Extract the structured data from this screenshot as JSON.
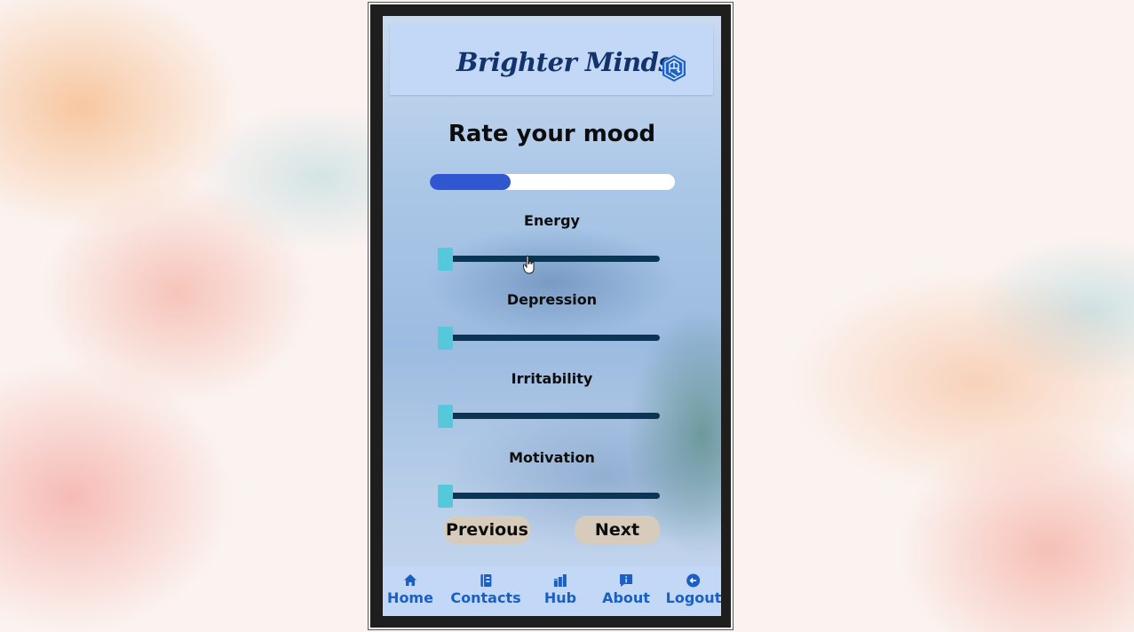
{
  "app": {
    "title": "Brighter Minds"
  },
  "page": {
    "title": "Rate your mood",
    "progress_fraction": 0.33
  },
  "sliders": [
    {
      "label": "Energy",
      "value": 0
    },
    {
      "label": "Depression",
      "value": 0
    },
    {
      "label": "Irritability",
      "value": 0
    },
    {
      "label": "Motivation",
      "value": 0
    }
  ],
  "buttons": {
    "previous": "Previous",
    "next": "Next"
  },
  "nav": [
    {
      "label": "Home",
      "icon": "home-icon"
    },
    {
      "label": "Contacts",
      "icon": "contacts-icon"
    },
    {
      "label": "Hub",
      "icon": "hub-icon"
    },
    {
      "label": "About",
      "icon": "about-icon"
    },
    {
      "label": "Logout",
      "icon": "logout-icon"
    }
  ],
  "colors": {
    "header_bg": "#c3d8f6",
    "brand_text": "#12336b",
    "progress_fill": "#3057d0",
    "slider_track": "#0b3554",
    "slider_thumb": "#56c8dc",
    "button_bg": "#d7cbbc",
    "nav_text": "#1a5fc4"
  }
}
